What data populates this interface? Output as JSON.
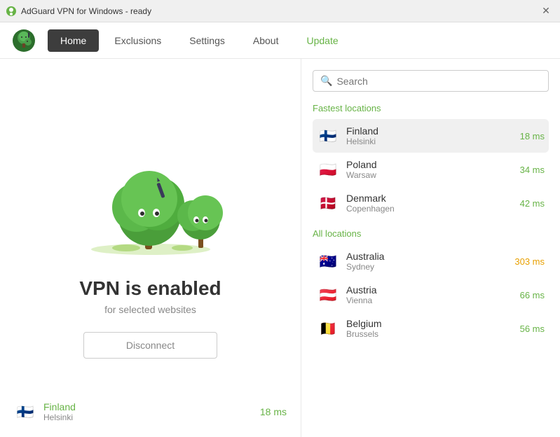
{
  "titlebar": {
    "title": "AdGuard VPN for Windows - ready",
    "close_label": "✕"
  },
  "navbar": {
    "logo_alt": "AdGuard VPN logo",
    "items": [
      {
        "id": "home",
        "label": "Home",
        "active": true
      },
      {
        "id": "exclusions",
        "label": "Exclusions",
        "active": false
      },
      {
        "id": "settings",
        "label": "Settings",
        "active": false
      },
      {
        "id": "about",
        "label": "About",
        "active": false
      },
      {
        "id": "update",
        "label": "Update",
        "active": false,
        "highlight": true
      }
    ]
  },
  "left_panel": {
    "vpn_status": "VPN is enabled",
    "vpn_subtitle": "for selected websites",
    "disconnect_label": "Disconnect",
    "current_location": {
      "name": "Finland",
      "city": "Helsinki",
      "ms": "18 ms"
    }
  },
  "right_panel": {
    "search_placeholder": "Search",
    "fastest_section_label": "Fastest locations",
    "fastest_locations": [
      {
        "country": "Finland",
        "city": "Helsinki",
        "ms": "18 ms",
        "flag": "🇫🇮",
        "selected": true,
        "slow": false
      },
      {
        "country": "Poland",
        "city": "Warsaw",
        "ms": "34 ms",
        "flag": "🇵🇱",
        "selected": false,
        "slow": false
      },
      {
        "country": "Denmark",
        "city": "Copenhagen",
        "ms": "42 ms",
        "flag": "🇩🇰",
        "selected": false,
        "slow": false
      }
    ],
    "all_section_label": "All locations",
    "all_locations": [
      {
        "country": "Australia",
        "city": "Sydney",
        "ms": "303 ms",
        "flag": "🇦🇺",
        "selected": false,
        "slow": true
      },
      {
        "country": "Austria",
        "city": "Vienna",
        "ms": "66 ms",
        "flag": "🇦🇹",
        "selected": false,
        "slow": false
      },
      {
        "country": "Belgium",
        "city": "Brussels",
        "ms": "56 ms",
        "flag": "🇧🇪",
        "selected": false,
        "slow": false
      }
    ]
  }
}
